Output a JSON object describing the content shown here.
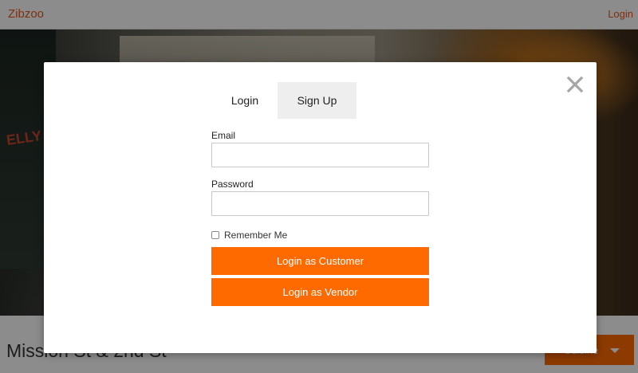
{
  "header": {
    "brand": "Zibzoo",
    "login_link": "Login"
  },
  "hero": {
    "board_text": "ELLY"
  },
  "location": {
    "title": "Mission St & 2nd St",
    "cuisine_button": "Cuisine"
  },
  "modal": {
    "tabs": [
      {
        "label": "Login",
        "active": false
      },
      {
        "label": "Sign Up",
        "active": true
      }
    ],
    "email": {
      "label": "Email",
      "value": "",
      "placeholder": ""
    },
    "password": {
      "label": "Password",
      "value": "",
      "placeholder": ""
    },
    "remember": {
      "label": "Remember Me",
      "checked": false
    },
    "login_customer": "Login as Customer",
    "login_vendor": "Login as Vendor",
    "close_icon": "close-icon"
  },
  "colors": {
    "accent": "#ff6a00",
    "brand": "#e8541e",
    "active_tab_bg": "#eeeeee"
  }
}
